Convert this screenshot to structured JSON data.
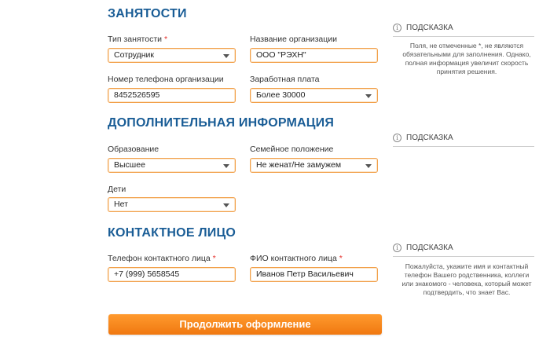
{
  "employment": {
    "heading": "ЗАНЯТОСТИ",
    "type_label": "Тип занятости",
    "type_value": "Сотрудник",
    "org_label": "Название организации",
    "org_value": "ООО \"РЭХН\"",
    "phone_label": "Номер телефона организации",
    "phone_value": "8452526595",
    "salary_label": "Заработная плата",
    "salary_value": "Более 30000"
  },
  "additional": {
    "heading": "ДОПОЛНИТЕЛЬНАЯ ИНФОРМАЦИЯ",
    "education_label": "Образование",
    "education_value": "Высшее",
    "family_label": "Семейное положение",
    "family_value": "Не женат/Не замужем",
    "children_label": "Дети",
    "children_value": "Нет"
  },
  "contact": {
    "heading": "КОНТАКТНОЕ ЛИЦО",
    "phone_label": "Телефон контактного лица",
    "phone_value": "+7 (999) 5658545",
    "name_label": "ФИО контактного лица",
    "name_value": "Иванов Петр Васильевич"
  },
  "required_mark": "*",
  "hints": {
    "title": "ПОДСКАЗКА",
    "hint1": "Поля, не отмеченные *, не являются обязательными для заполнения. Однако, полная информация увеличит скорость принятия решения.",
    "hint3": "Пожалуйста, укажите имя и контактный телефон Вашего родственника, коллеги или знакомого - человека, который может подтвердить, что знает Вас."
  },
  "cta_label": "Продолжить оформление",
  "colors": {
    "accent": "#f07810",
    "heading": "#1a5d96",
    "border": "#f2a04a"
  }
}
